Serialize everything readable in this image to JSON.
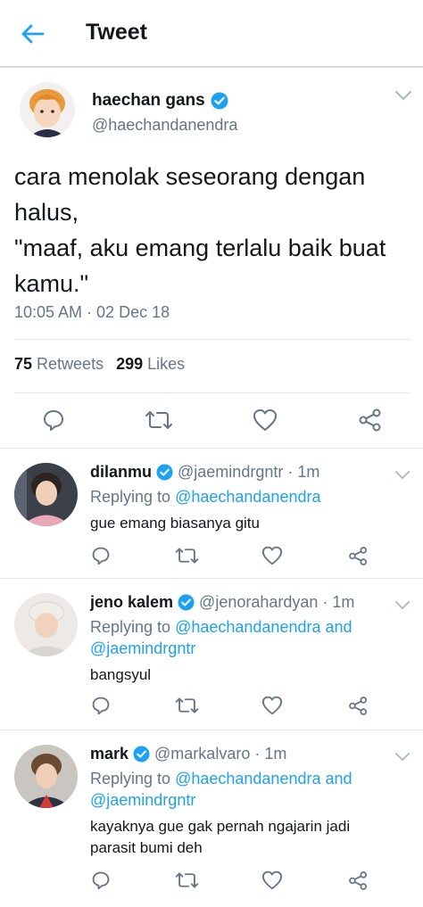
{
  "header": {
    "title": "Tweet",
    "back_icon": "back-arrow-icon"
  },
  "tweet": {
    "author_name": "haechan gans",
    "author_handle": "@haechandanendra",
    "text": "cara menolak seseorang dengan halus,\n\"maaf, aku emang terlalu baik buat kamu.\"",
    "time": "10:05 AM · 02 Dec 18",
    "retweets_count": "75",
    "retweets_label": "Retweets",
    "likes_count": "299",
    "likes_label": "Likes"
  },
  "replies": [
    {
      "name": "dilanmu",
      "handle": "@jaemindrgntr",
      "age": "1m",
      "replying_label": "Replying to",
      "replying_to": "@haechandanendra",
      "text": "gue emang biasanya gitu"
    },
    {
      "name": "jeno kalem",
      "handle": "@jenorahardyan",
      "age": "1m",
      "replying_label": "Replying to",
      "replying_to": "@haechandanendra and @jaemindrgntr",
      "text": "bangsyul"
    },
    {
      "name": "mark",
      "handle": "@markalvaro",
      "age": "1m",
      "replying_label": "Replying to",
      "replying_to": "@haechandanendra and @jaemindrgntr",
      "text": "kayaknya gue gak pernah ngajarin jadi parasit bumi deh"
    }
  ],
  "colors": {
    "accent": "#1da1f2",
    "verified": "#1da1f2",
    "muted": "#657786",
    "text": "#14171a",
    "divider": "#e1e8ed"
  },
  "icons": [
    "back-arrow-icon",
    "verified-badge-icon",
    "chevron-down-icon",
    "reply-icon",
    "retweet-icon",
    "like-icon",
    "share-icon"
  ]
}
